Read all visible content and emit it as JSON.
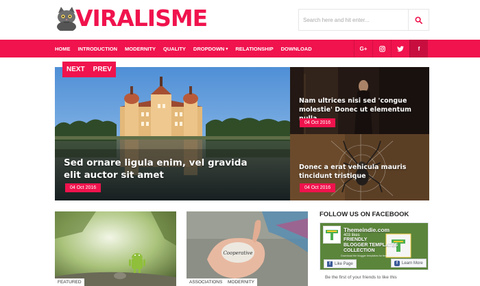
{
  "brand": {
    "name": "VIRALISME",
    "accent": "#f0134d"
  },
  "search": {
    "placeholder": "Search here and hit enter..."
  },
  "nav": {
    "items": [
      {
        "label": "HOME"
      },
      {
        "label": "INTRODUCTION"
      },
      {
        "label": "MODERNITY"
      },
      {
        "label": "QUALITY"
      },
      {
        "label": "DROPDOWN",
        "has_dropdown": true
      },
      {
        "label": "RELATIONSHIP"
      },
      {
        "label": "DOWNLOAD"
      }
    ],
    "social": [
      {
        "label": "G+",
        "icon": "google-plus-icon"
      },
      {
        "label": "",
        "icon": "instagram-icon"
      },
      {
        "label": "",
        "icon": "twitter-icon"
      },
      {
        "label": "f",
        "icon": "facebook-icon"
      }
    ]
  },
  "slider": {
    "next": "NEXT",
    "prev": "PREV"
  },
  "hero": {
    "main": {
      "title": "Sed ornare ligula enim, vel gravida elit auctor sit amet",
      "date": "04 Oct 2016"
    },
    "side1": {
      "title": "Nam ultrices nisi sed 'congue molestie' Donec ut elementum nulla",
      "date": "04 Oct 2016"
    },
    "side2": {
      "title": "Donec a erat vehicula mauris tincidunt tristique",
      "date": "04 Oct 2016"
    }
  },
  "cards": [
    {
      "tags": [
        "FEATURED"
      ]
    },
    {
      "tags": [
        "ASSOCIATIONS",
        "MODERNITY"
      ],
      "stone_text": "Cooperative"
    }
  ],
  "facebook": {
    "title": "FOLLOW US ON FACEBOOK",
    "page_name": "Themeindie.com",
    "likes": "403 likes",
    "banner_text": [
      "FRIENDLY",
      "BLOGGER TEMPLATES",
      "COLLECTION"
    ],
    "small_text": "Download the blogger templates for free, NOW!",
    "like_label": "Like Page",
    "learn_more_label": "Learn More",
    "friends_text": "Be the first of your friends to like this"
  }
}
